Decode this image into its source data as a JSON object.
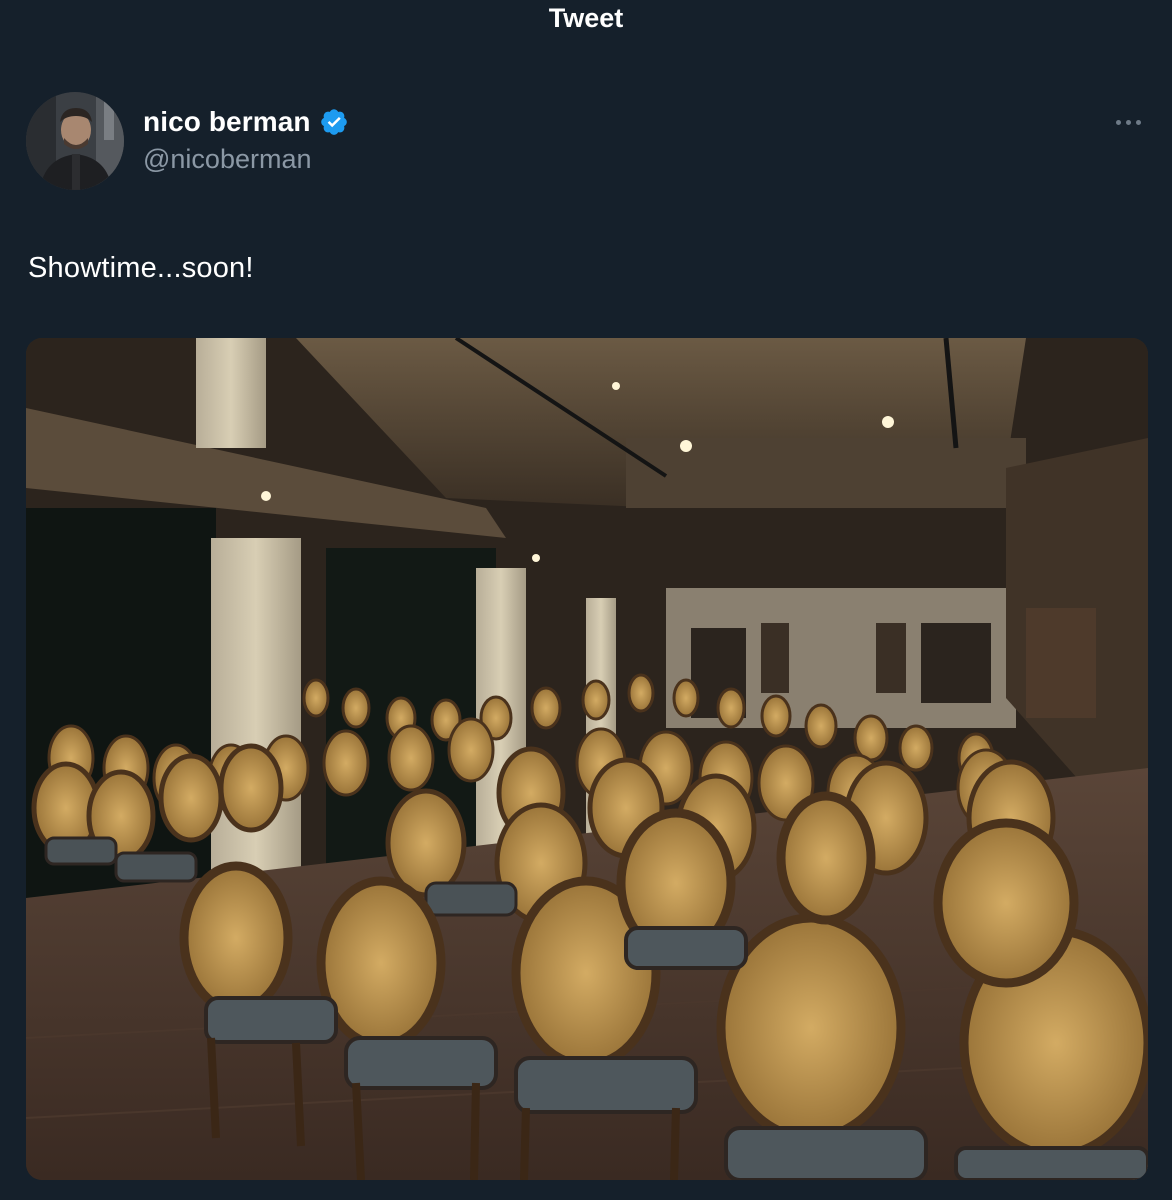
{
  "header": {
    "title": "Tweet"
  },
  "author": {
    "display_name": "nico berman",
    "handle": "@nicoberman",
    "verified": true,
    "avatar_icon": "avatar-photo"
  },
  "tweet": {
    "text": "Showtime...soon!",
    "media_icon": "photo-event-hall-with-rows-of-cane-chairs"
  },
  "colors": {
    "background": "#15202b",
    "secondary_text": "#8b98a5",
    "verified_badge": "#1d9bf0"
  }
}
